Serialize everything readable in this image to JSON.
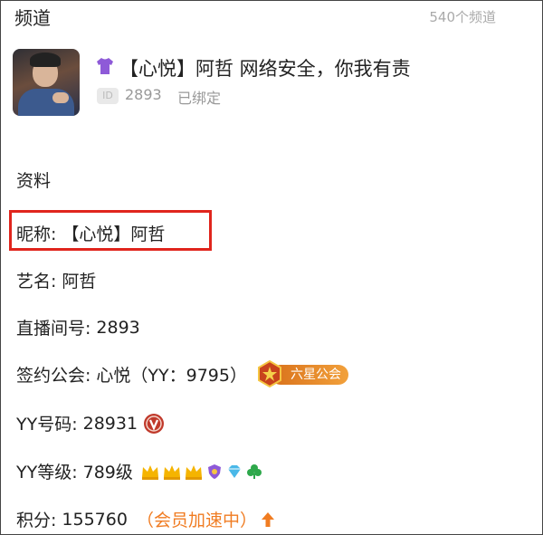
{
  "header": {
    "title": "频道",
    "channel_count": "540个频道"
  },
  "profile": {
    "name": "【心悦】阿哲  网络安全，你我有责",
    "id_badge": "ID",
    "id_number": "2893",
    "bound_status": "已绑定"
  },
  "info": {
    "section_title": "资料",
    "nickname": {
      "label": "昵称:",
      "value": "【心悦】阿哲"
    },
    "stage_name": {
      "label": "艺名:",
      "value": "阿哲"
    },
    "room_number": {
      "label": "直播间号:",
      "value": "2893"
    },
    "guild": {
      "label": "签约公会:",
      "value": "心悦（YY：9795）",
      "badge": "六星公会"
    },
    "yy_number": {
      "label": "YY号码:",
      "value": "28931"
    },
    "yy_level": {
      "label": "YY等级:",
      "value": "789级"
    },
    "points": {
      "label": "积分:",
      "value": "155760",
      "status": "（会员加速中）"
    }
  },
  "colors": {
    "highlight_border": "#e0251d",
    "accent_orange": "#f07c22",
    "crown": "#f5b400",
    "purple": "#8e5ad8"
  },
  "icons": [
    "shirt-icon",
    "guild-emblem-icon",
    "vip-icon",
    "crown-icon",
    "shield-icon",
    "diamond-icon",
    "clover-icon",
    "arrow-up-icon"
  ]
}
